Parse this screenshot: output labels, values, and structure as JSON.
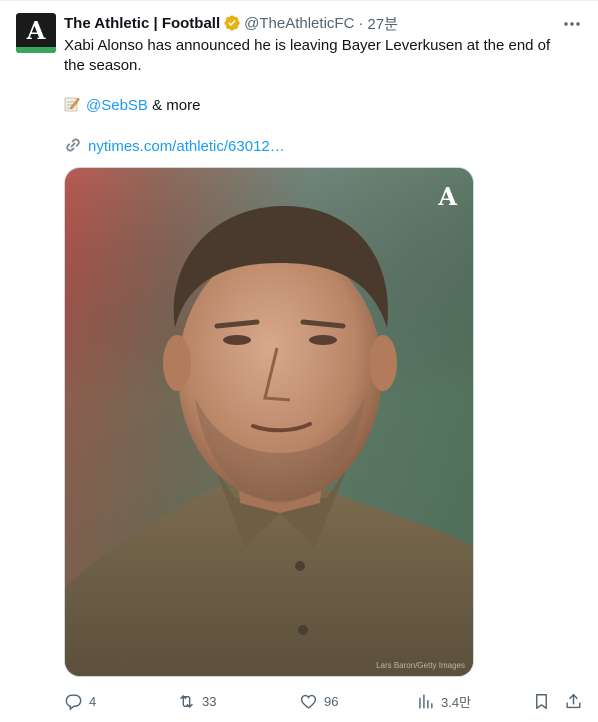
{
  "author": {
    "name": "The Athletic | Football",
    "handle": "@TheAthleticFC",
    "separator": "·",
    "time": "27분",
    "avatar_letter": "A",
    "verified_color": "#e8b117"
  },
  "tweet": {
    "line1": "Xabi Alonso has announced he is leaving Bayer Leverkusen at the end of",
    "line2": "the season.",
    "credit_mention": "@SebSB",
    "credit_suffix": " & more",
    "link_text": "nytimes.com/athletic/63012…"
  },
  "media": {
    "logo": "A",
    "photo_credit": "Lars Baron/Getty Images"
  },
  "actions": {
    "replies": "4",
    "retweets": "33",
    "likes": "96",
    "views": "3.4만"
  },
  "colors": {
    "link": "#1d9bf0",
    "muted": "#536471",
    "text": "#0f1419"
  }
}
